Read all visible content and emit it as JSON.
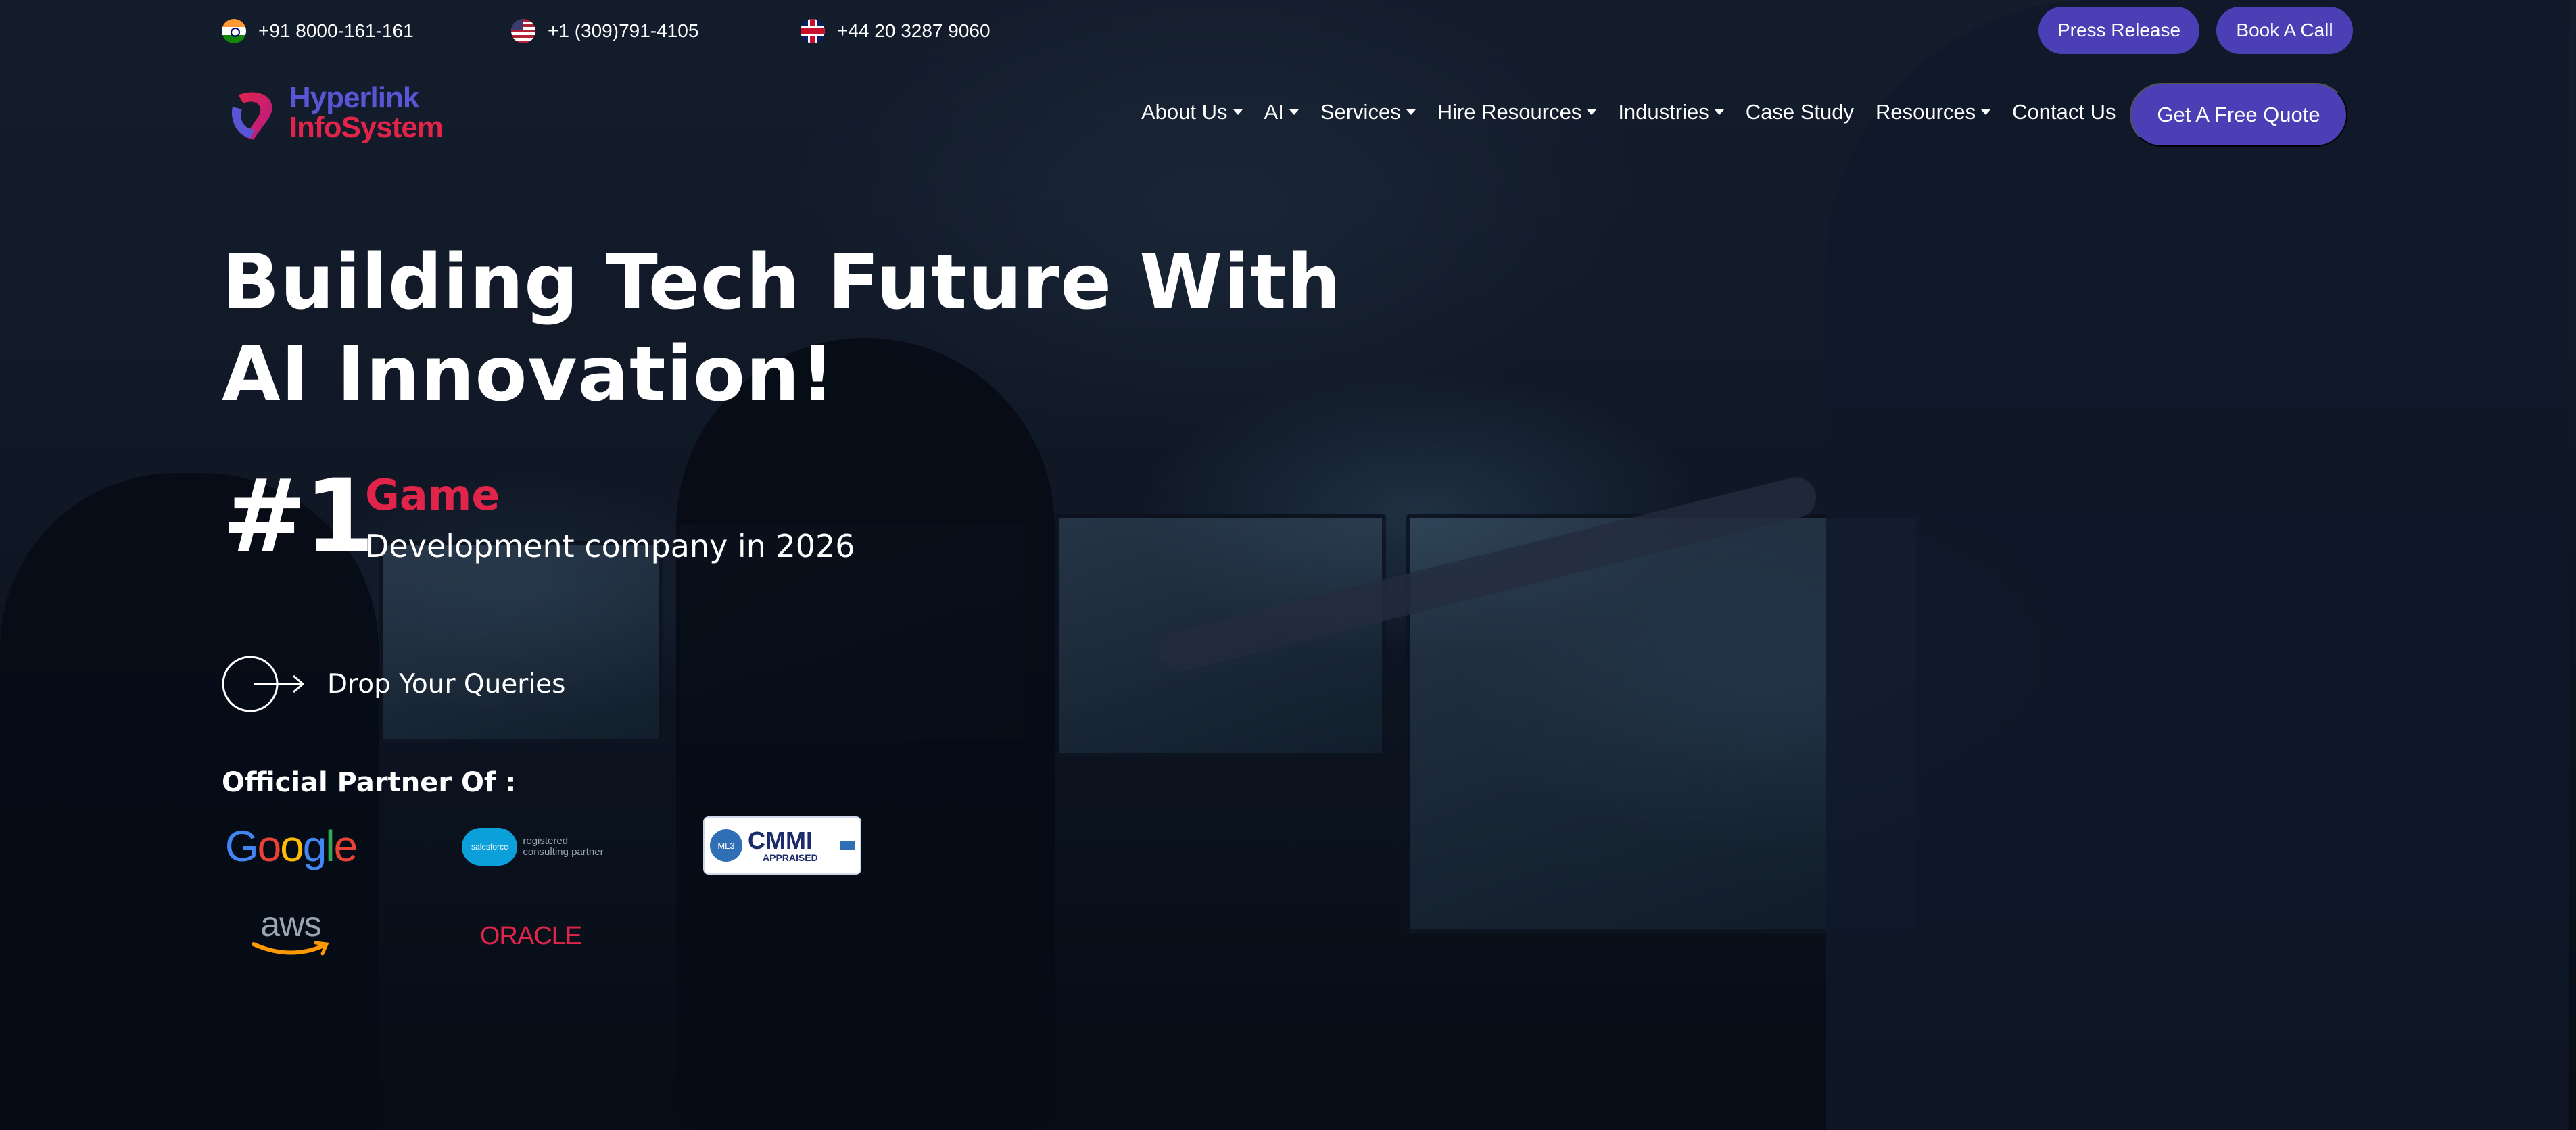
{
  "topbar": {
    "phones": [
      {
        "number": "+91 8000-161-161",
        "flag": "india-flag-icon"
      },
      {
        "number": "+1 (309)791-4105",
        "flag": "usa-flag-icon"
      },
      {
        "number": "+44 20 3287 9060",
        "flag": "uk-flag-icon"
      }
    ],
    "press_release_label": "Press Release",
    "book_call_label": "Book A Call"
  },
  "logo": {
    "line1": "Hyperlink",
    "line2": "InfoSystem"
  },
  "nav": {
    "items": [
      {
        "label": "About Us",
        "dropdown": true
      },
      {
        "label": "AI",
        "dropdown": true
      },
      {
        "label": "Services",
        "dropdown": true
      },
      {
        "label": "Hire Resources",
        "dropdown": true
      },
      {
        "label": "Industries",
        "dropdown": true
      },
      {
        "label": "Case Study",
        "dropdown": false
      },
      {
        "label": "Resources",
        "dropdown": true
      },
      {
        "label": "Contact Us",
        "dropdown": false
      }
    ],
    "cta_label": "Get A Free Quote"
  },
  "hero": {
    "headline_line1": "Building Tech Future With",
    "headline_line2": "AI Innovation!",
    "rank": "#1",
    "rank_service": "Game",
    "rank_subtitle": "Development company in 2026",
    "queries_label": "Drop Your Queries",
    "partner_title": "Official Partner Of :"
  },
  "partners": {
    "google": [
      "G",
      "o",
      "o",
      "g",
      "l",
      "e"
    ],
    "salesforce_badge": "salesforce",
    "salesforce_line1": "registered",
    "salesforce_line2": "consulting partner",
    "cmmi_level": "ML3",
    "cmmi_title": "CMMI",
    "cmmi_sub": "APPRAISED",
    "aws": "aws",
    "oracle": "ORACLE"
  },
  "colors": {
    "accent_purple": "#4a3fb5",
    "accent_red": "#e0244a"
  }
}
